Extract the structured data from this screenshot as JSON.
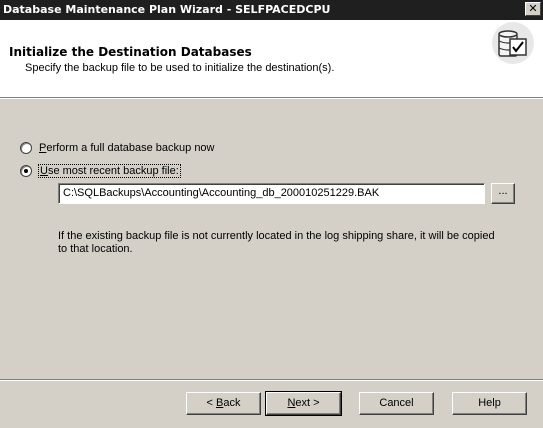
{
  "window": {
    "title": "Database Maintenance Plan Wizard - SELFPACEDCPU",
    "close_label": "✕"
  },
  "header": {
    "title": "Initialize the Destination Databases",
    "subtitle": "Specify the backup file to be used to initialize the destination(s).",
    "icon": "database-check-icon"
  },
  "options": {
    "full_backup": {
      "label": "Perform a full database backup now",
      "selected": false,
      "mnemonic": "P"
    },
    "recent_backup": {
      "label": "Use most recent backup file:",
      "selected": true,
      "mnemonic": "U"
    }
  },
  "backup_file": {
    "value": "C:\\SQLBackups\\Accounting\\Accounting_db_200010251229.BAK",
    "browse_label": "..."
  },
  "info": {
    "text": "If the existing backup file is not currently located in the log shipping share, it will be copied to that location."
  },
  "buttons": {
    "back": {
      "prefix": "< ",
      "mnemonic": "B",
      "rest": "ack"
    },
    "next": {
      "mnemonic": "N",
      "rest": "ext >"
    },
    "cancel": "Cancel",
    "help": "Help"
  }
}
